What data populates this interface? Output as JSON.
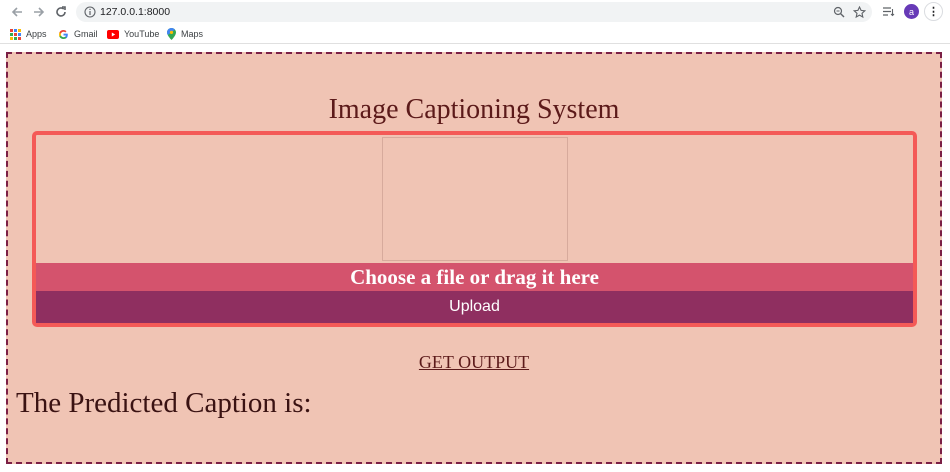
{
  "browser": {
    "url": "127.0.0.1:8000",
    "avatar_letter": "a",
    "bookmarks": [
      {
        "label": "Apps",
        "icon": "apps-grid-icon"
      },
      {
        "label": "Gmail",
        "icon": "google-icon"
      },
      {
        "label": "YouTube",
        "icon": "youtube-icon"
      },
      {
        "label": "Maps",
        "icon": "maps-pin-icon"
      }
    ]
  },
  "page": {
    "title": "Image Captioning System",
    "dropzone_label": "Choose a file or drag it here",
    "upload_label": "Upload",
    "get_output_label": "GET OUTPUT",
    "caption_label": "The Predicted Caption is:"
  }
}
